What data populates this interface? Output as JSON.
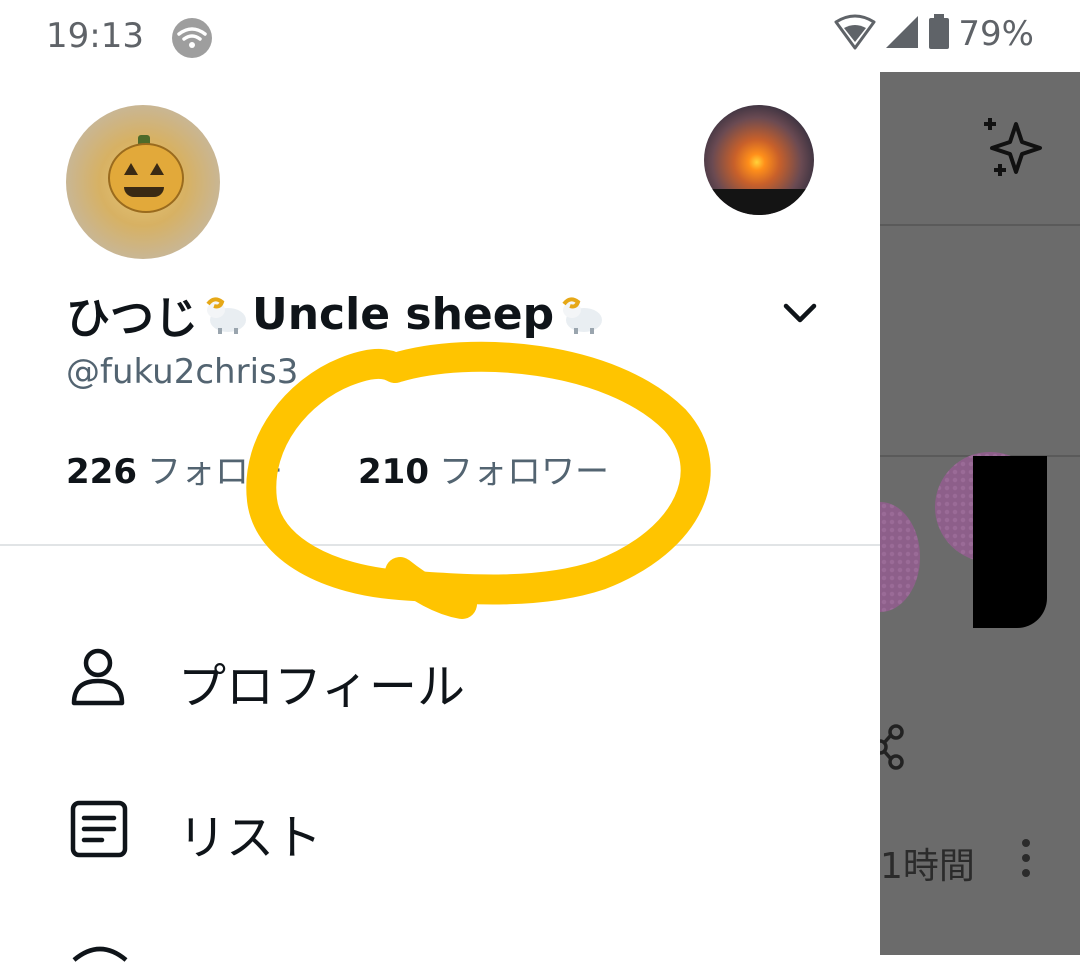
{
  "status_bar": {
    "time": "19:13",
    "battery": "79%"
  },
  "drawer": {
    "display_name_jp": "ひつじ",
    "display_name_en": "Uncle sheep",
    "handle": "@fuku2chris3",
    "following_count": "226",
    "following_label": "フォロー",
    "followers_count": "210",
    "followers_label": "フォロワー",
    "menu": [
      {
        "label": "プロフィール",
        "icon": "person-icon"
      },
      {
        "label": "リスト",
        "icon": "list-icon"
      }
    ]
  },
  "timeline": {
    "time_label": "1時間"
  },
  "colors": {
    "annotation": "#ffc400",
    "text_primary": "#0f1419",
    "text_secondary": "#536471",
    "overlay": "#6b6b6b"
  }
}
